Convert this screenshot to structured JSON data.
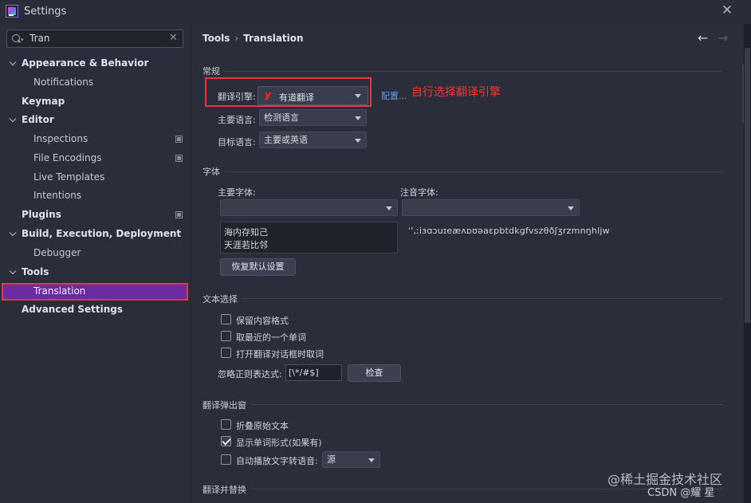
{
  "window": {
    "title": "Settings"
  },
  "search": {
    "value": "Tran"
  },
  "sidebar": {
    "items": [
      {
        "label": "Appearance & Behavior"
      },
      {
        "label": "Notifications"
      },
      {
        "label": "Keymap"
      },
      {
        "label": "Editor"
      },
      {
        "label": "Inspections"
      },
      {
        "label": "File Encodings"
      },
      {
        "label": "Live Templates"
      },
      {
        "label": "Intentions"
      },
      {
        "label": "Plugins"
      },
      {
        "label": "Build, Execution, Deployment"
      },
      {
        "label": "Debugger"
      },
      {
        "label": "Tools"
      },
      {
        "label": "Translation"
      },
      {
        "label": "Advanced Settings"
      }
    ]
  },
  "breadcrumb": {
    "parent": "Tools",
    "current": "Translation"
  },
  "general": {
    "section": "常规",
    "engine_label": "翻译引擎:",
    "engine_value": "有道翻译",
    "engine_icon": "y",
    "config_link": "配置...",
    "annotation": "自行选择翻译引擎",
    "primary_lang_label": "主要语言:",
    "primary_lang_value": "检测语言",
    "target_lang_label": "目标语言:",
    "target_lang_value": "主要或英语"
  },
  "font": {
    "section": "字体",
    "primary_font_label": "主要字体:",
    "phonetic_font_label": "注音字体:",
    "preview_line1": "海内存知己",
    "preview_line2": "天涯若比邻",
    "phonetic_sample": "ˈ',ːiɜɑɔuɪeæʌɒʊəaɛpbtdkgfvszθðʃʒrzmnŋhljw",
    "restore_button": "恢复默认设置"
  },
  "text_selection": {
    "section": "文本选择",
    "opt_keep_format": "保留内容格式",
    "opt_nearest_word": "取最近的一个单词",
    "opt_pick_on_open": "打开翻译对话框时取词",
    "ignore_regex_label": "忽略正则表达式:",
    "ignore_regex_value": "[\\*/#$]",
    "check_button": "检查"
  },
  "popup": {
    "section": "翻译弹出窗",
    "opt_fold_original": "折叠原始文本",
    "opt_show_word_forms": "显示单词形式(如果有)",
    "opt_autoplay_tts": "自动播放文字转语音:",
    "tts_value": "源"
  },
  "replace": {
    "section": "翻译并替换"
  },
  "watermark": {
    "line1": "@稀土掘金技术社区",
    "line2": "CSDN @耀 星"
  }
}
